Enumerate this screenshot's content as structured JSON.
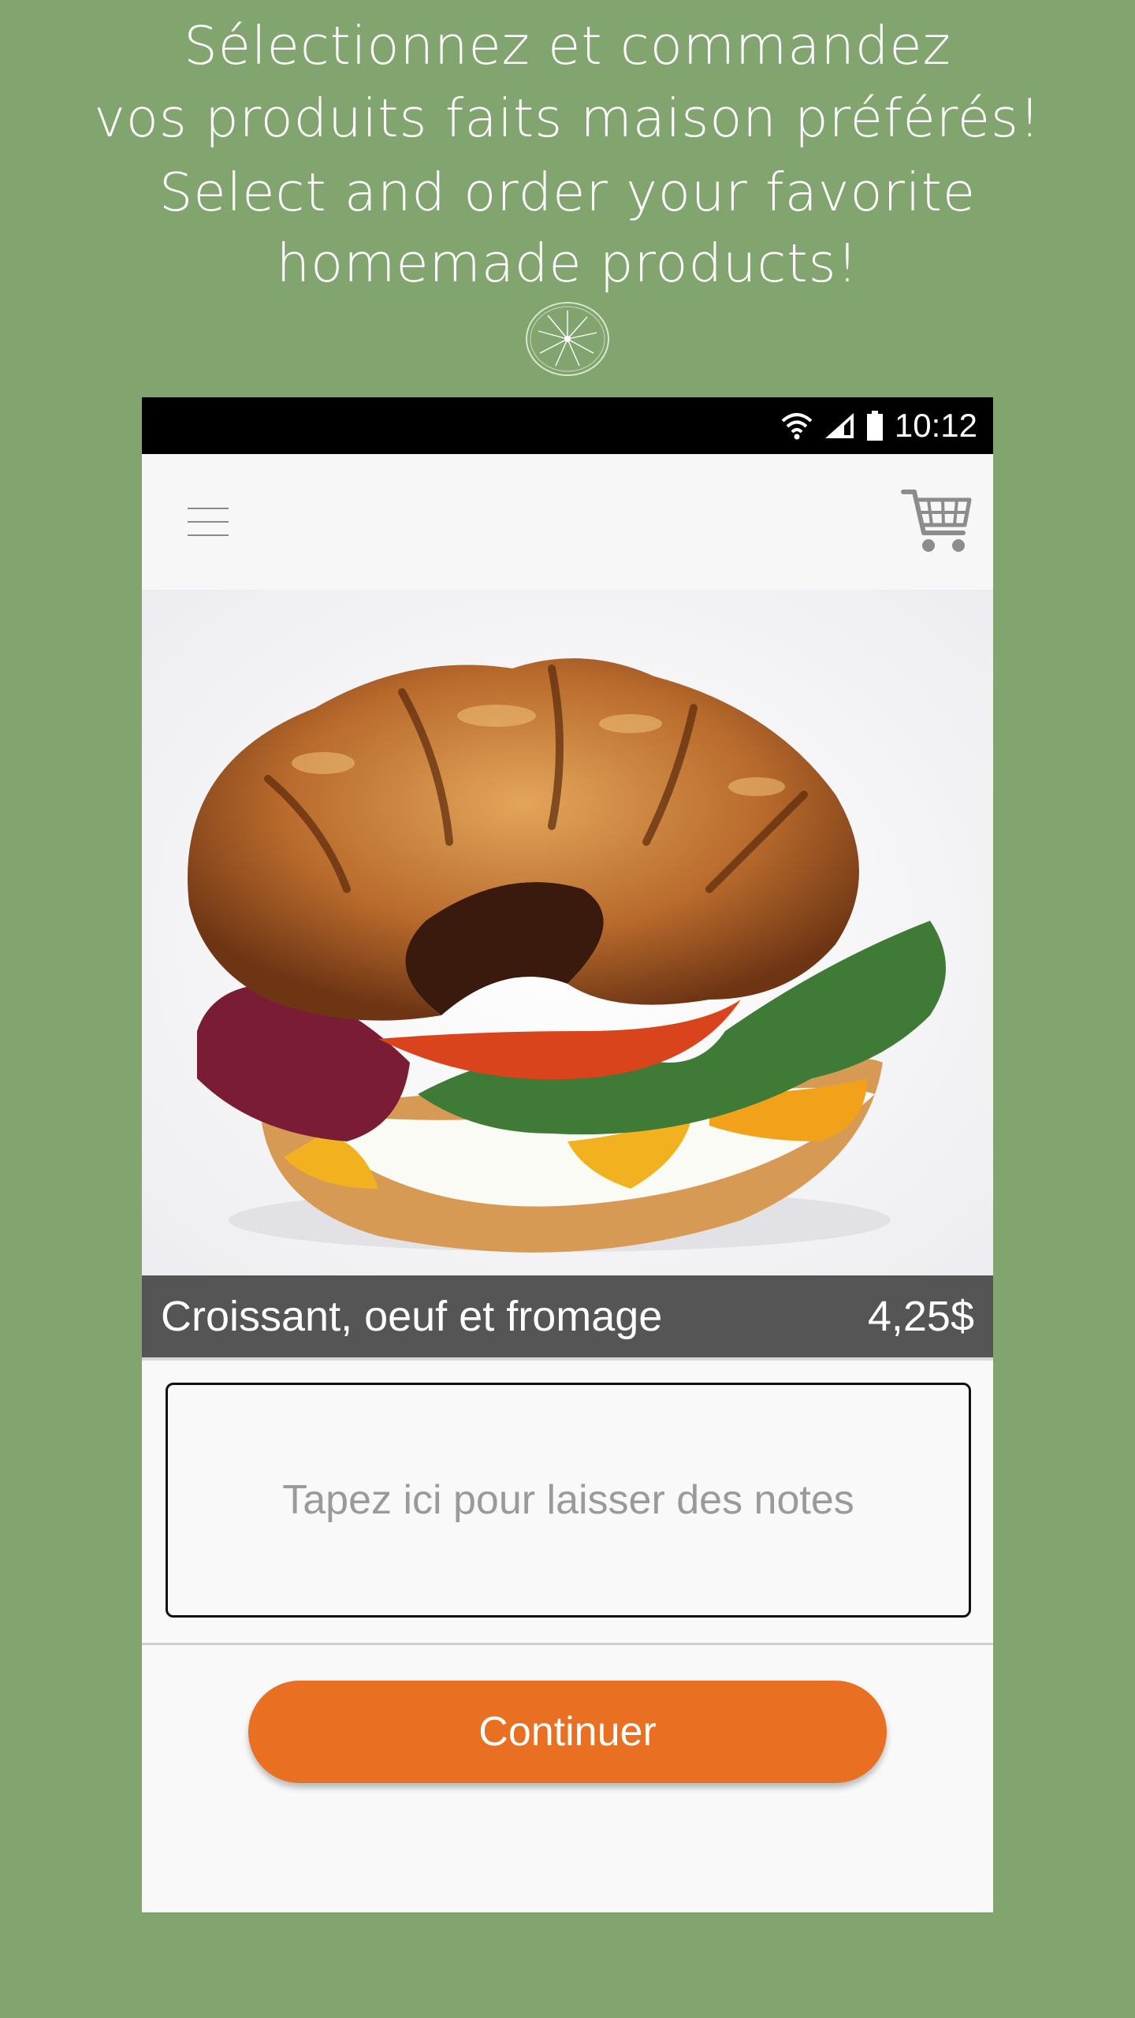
{
  "promo": {
    "line1": "Sélectionnez et commandez",
    "line2": "vos produits faits maison préférés!",
    "line3": "Select and order your favorite",
    "line4": "homemade products!"
  },
  "status_bar": {
    "time": "10:12",
    "icons": [
      "wifi-icon",
      "signal-icon",
      "battery-icon"
    ]
  },
  "app_bar": {
    "menu_icon": "hamburger-menu-icon",
    "cart_icon": "shopping-cart-icon"
  },
  "product": {
    "name": "Croissant, oeuf et fromage",
    "price": "4,25$"
  },
  "notes": {
    "placeholder": "Tapez ici pour laisser des notes"
  },
  "actions": {
    "continue_label": "Continuer"
  },
  "colors": {
    "background": "#82a570",
    "accent": "#e96f22",
    "caption_bar": "#555555"
  }
}
